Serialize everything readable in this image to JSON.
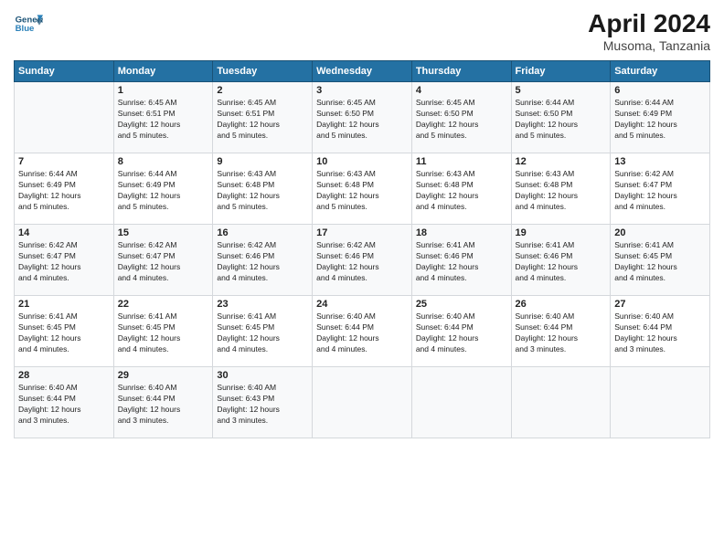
{
  "header": {
    "title": "April 2024",
    "subtitle": "Musoma, Tanzania"
  },
  "days": [
    "Sunday",
    "Monday",
    "Tuesday",
    "Wednesday",
    "Thursday",
    "Friday",
    "Saturday"
  ],
  "weeks": [
    [
      {
        "num": "",
        "text": ""
      },
      {
        "num": "1",
        "text": "Sunrise: 6:45 AM\nSunset: 6:51 PM\nDaylight: 12 hours\nand 5 minutes."
      },
      {
        "num": "2",
        "text": "Sunrise: 6:45 AM\nSunset: 6:51 PM\nDaylight: 12 hours\nand 5 minutes."
      },
      {
        "num": "3",
        "text": "Sunrise: 6:45 AM\nSunset: 6:50 PM\nDaylight: 12 hours\nand 5 minutes."
      },
      {
        "num": "4",
        "text": "Sunrise: 6:45 AM\nSunset: 6:50 PM\nDaylight: 12 hours\nand 5 minutes."
      },
      {
        "num": "5",
        "text": "Sunrise: 6:44 AM\nSunset: 6:50 PM\nDaylight: 12 hours\nand 5 minutes."
      },
      {
        "num": "6",
        "text": "Sunrise: 6:44 AM\nSunset: 6:49 PM\nDaylight: 12 hours\nand 5 minutes."
      }
    ],
    [
      {
        "num": "7",
        "text": "Sunrise: 6:44 AM\nSunset: 6:49 PM\nDaylight: 12 hours\nand 5 minutes."
      },
      {
        "num": "8",
        "text": "Sunrise: 6:44 AM\nSunset: 6:49 PM\nDaylight: 12 hours\nand 5 minutes."
      },
      {
        "num": "9",
        "text": "Sunrise: 6:43 AM\nSunset: 6:48 PM\nDaylight: 12 hours\nand 5 minutes."
      },
      {
        "num": "10",
        "text": "Sunrise: 6:43 AM\nSunset: 6:48 PM\nDaylight: 12 hours\nand 5 minutes."
      },
      {
        "num": "11",
        "text": "Sunrise: 6:43 AM\nSunset: 6:48 PM\nDaylight: 12 hours\nand 4 minutes."
      },
      {
        "num": "12",
        "text": "Sunrise: 6:43 AM\nSunset: 6:48 PM\nDaylight: 12 hours\nand 4 minutes."
      },
      {
        "num": "13",
        "text": "Sunrise: 6:42 AM\nSunset: 6:47 PM\nDaylight: 12 hours\nand 4 minutes."
      }
    ],
    [
      {
        "num": "14",
        "text": "Sunrise: 6:42 AM\nSunset: 6:47 PM\nDaylight: 12 hours\nand 4 minutes."
      },
      {
        "num": "15",
        "text": "Sunrise: 6:42 AM\nSunset: 6:47 PM\nDaylight: 12 hours\nand 4 minutes."
      },
      {
        "num": "16",
        "text": "Sunrise: 6:42 AM\nSunset: 6:46 PM\nDaylight: 12 hours\nand 4 minutes."
      },
      {
        "num": "17",
        "text": "Sunrise: 6:42 AM\nSunset: 6:46 PM\nDaylight: 12 hours\nand 4 minutes."
      },
      {
        "num": "18",
        "text": "Sunrise: 6:41 AM\nSunset: 6:46 PM\nDaylight: 12 hours\nand 4 minutes."
      },
      {
        "num": "19",
        "text": "Sunrise: 6:41 AM\nSunset: 6:46 PM\nDaylight: 12 hours\nand 4 minutes."
      },
      {
        "num": "20",
        "text": "Sunrise: 6:41 AM\nSunset: 6:45 PM\nDaylight: 12 hours\nand 4 minutes."
      }
    ],
    [
      {
        "num": "21",
        "text": "Sunrise: 6:41 AM\nSunset: 6:45 PM\nDaylight: 12 hours\nand 4 minutes."
      },
      {
        "num": "22",
        "text": "Sunrise: 6:41 AM\nSunset: 6:45 PM\nDaylight: 12 hours\nand 4 minutes."
      },
      {
        "num": "23",
        "text": "Sunrise: 6:41 AM\nSunset: 6:45 PM\nDaylight: 12 hours\nand 4 minutes."
      },
      {
        "num": "24",
        "text": "Sunrise: 6:40 AM\nSunset: 6:44 PM\nDaylight: 12 hours\nand 4 minutes."
      },
      {
        "num": "25",
        "text": "Sunrise: 6:40 AM\nSunset: 6:44 PM\nDaylight: 12 hours\nand 4 minutes."
      },
      {
        "num": "26",
        "text": "Sunrise: 6:40 AM\nSunset: 6:44 PM\nDaylight: 12 hours\nand 3 minutes."
      },
      {
        "num": "27",
        "text": "Sunrise: 6:40 AM\nSunset: 6:44 PM\nDaylight: 12 hours\nand 3 minutes."
      }
    ],
    [
      {
        "num": "28",
        "text": "Sunrise: 6:40 AM\nSunset: 6:44 PM\nDaylight: 12 hours\nand 3 minutes."
      },
      {
        "num": "29",
        "text": "Sunrise: 6:40 AM\nSunset: 6:44 PM\nDaylight: 12 hours\nand 3 minutes."
      },
      {
        "num": "30",
        "text": "Sunrise: 6:40 AM\nSunset: 6:43 PM\nDaylight: 12 hours\nand 3 minutes."
      },
      {
        "num": "",
        "text": ""
      },
      {
        "num": "",
        "text": ""
      },
      {
        "num": "",
        "text": ""
      },
      {
        "num": "",
        "text": ""
      }
    ]
  ]
}
